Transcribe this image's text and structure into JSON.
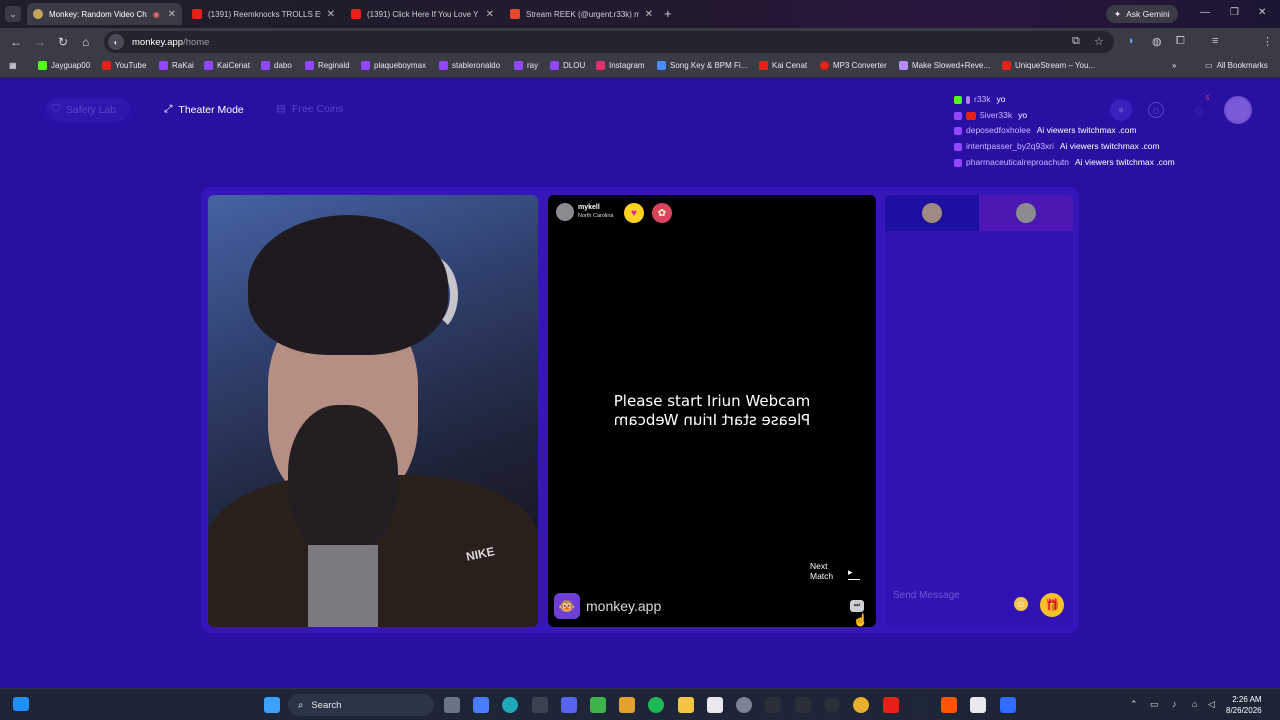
{
  "browser": {
    "tabs": [
      {
        "title": "Monkey: Random Video Ch",
        "active": true,
        "color": "#c8a55a"
      },
      {
        "title": "(1391) Reemknocks TROLLS Ev",
        "active": false,
        "color": "#e62117"
      },
      {
        "title": "(1391) Click Here If You Love Y",
        "active": false,
        "color": "#e62117"
      },
      {
        "title": "Stream REEK (@urgent.r33k) m",
        "active": false,
        "color": "#e8452c"
      }
    ],
    "ask_gemini": "Ask Gemini",
    "url_host": "monkey.app",
    "url_path": "/home",
    "bookmarks": [
      {
        "label": "Jayguap00",
        "color": "#53fc18"
      },
      {
        "label": "YouTube",
        "color": "#e62117"
      },
      {
        "label": "RaKai",
        "color": "#9146ff"
      },
      {
        "label": "KaiCenat",
        "color": "#9146ff"
      },
      {
        "label": "dabo",
        "color": "#9146ff"
      },
      {
        "label": "Reginald",
        "color": "#9146ff"
      },
      {
        "label": "plaqueboymax",
        "color": "#9146ff"
      },
      {
        "label": "stableronaldo",
        "color": "#9146ff"
      },
      {
        "label": "ray",
        "color": "#9146ff"
      },
      {
        "label": "DLOU",
        "color": "#9146ff"
      },
      {
        "label": "Instagram",
        "color": "#e1306c"
      },
      {
        "label": "Song Key & BPM Fi...",
        "color": "#4a8cff"
      },
      {
        "label": "Kai Cenat",
        "color": "#e62117"
      },
      {
        "label": "MP3 Converter",
        "color": "#e62117"
      },
      {
        "label": "Make Slowed+Reve...",
        "color": "#b38cff"
      },
      {
        "label": "UniqueStream – You...",
        "color": "#e62117"
      }
    ],
    "all_bookmarks": "All Bookmarks"
  },
  "page": {
    "safety_lab": "Safety Lab",
    "theater_mode": "Theater Mode",
    "free_coins": "Free Coins",
    "notif_count": "5"
  },
  "chat_overlay": [
    {
      "user": "r33k",
      "msg": "yo",
      "color": "#53fc18"
    },
    {
      "user": "5iver33k",
      "msg": "yo",
      "color": "#e62117"
    },
    {
      "user": "deposedfoxholee",
      "msg": "Ai viewers twitchmax .com",
      "color": "#9146ff"
    },
    {
      "user": "intentpasser_by2q93xri",
      "msg": "Ai viewers twitchmax .com",
      "color": "#9146ff"
    },
    {
      "user": "pharmaceuticalreproachutn",
      "msg": "Ai viewers twitchmax .com",
      "color": "#9146ff"
    }
  ],
  "video": {
    "left_cam_logo": "NIKE",
    "remote_user": "mykell",
    "remote_location": "North Carolina",
    "webcam_msg": "Please start Iriun Webcam",
    "next_match": "Next Match",
    "brand": "monkey.app"
  },
  "chat_panel": {
    "placeholder": "Send Message"
  },
  "taskbar": {
    "search": "Search",
    "time": "2:26 AM",
    "date": "8/26/2026"
  }
}
